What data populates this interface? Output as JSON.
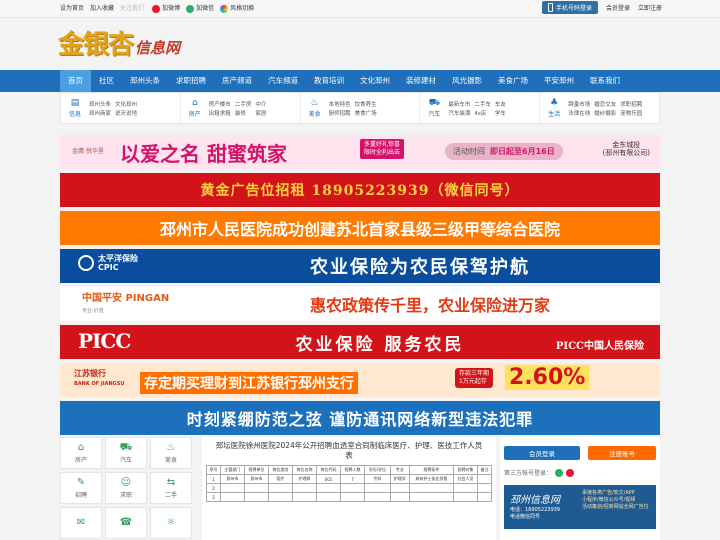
{
  "topbar": {
    "set_home": "设为首页",
    "add_fav": "加入收藏",
    "follow_us": "关注我们:",
    "weibo": "加微博",
    "wechat": "加微信",
    "style_switch": "风格切换",
    "mobile_login": "手机号码登录",
    "member_login": "会员登录",
    "logout": "立即注册"
  },
  "logo": {
    "main": "金银杏",
    "sub": "信息网"
  },
  "nav": {
    "items": [
      "首页",
      "社区",
      "邳州头条",
      "求职招聘",
      "房产频道",
      "汽车频道",
      "教育培训",
      "文化邳州",
      "装修建材",
      "风光摄影",
      "美食广场",
      "平安邳州",
      "联系我们"
    ]
  },
  "subnav": [
    {
      "cat": "信息",
      "glyph": "▤",
      "links": [
        "邳州头条",
        "文化邳州",
        "",
        "邳州商家",
        "说天说地",
        ""
      ]
    },
    {
      "cat": "房产",
      "glyph": "⌂",
      "links": [
        "房产楼市",
        "二手房",
        "中介",
        "出租求租",
        "装修",
        "家居"
      ]
    },
    {
      "cat": "美食",
      "glyph": "♨",
      "links": [
        "本地特色",
        "饮食养生",
        "",
        "厨师招聘",
        "美食广场",
        ""
      ]
    },
    {
      "cat": "汽车",
      "glyph": "⛟",
      "links": [
        "最新车市",
        "二手车",
        "车友",
        "汽车装潢",
        "4s店",
        "学车"
      ]
    },
    {
      "cat": "生活",
      "glyph": "♣",
      "links": [
        "跳蚤市场",
        "婚恋交友",
        "求职招聘",
        "法律在线",
        "婚纱摄影",
        "宠物乐园"
      ]
    }
  ],
  "banners": {
    "b1": {
      "brand": "金鹰·悦华里",
      "main": "以爱之名 甜蜜筑家",
      "badge1": "多重好礼惊喜",
      "badge2": "限时全利出击",
      "activity_label": "活动时间",
      "activity_date": "即日起至6月16日",
      "corner1": "金东城投",
      "corner2": "(邳州有限公司)"
    },
    "b2": {
      "text": "黄金广告位招租 18905223939（微信同号）"
    },
    "b3": {
      "text": "邳州市人民医院成功创建苏北首家县级三级甲等综合医院"
    },
    "b4": {
      "logo_cn": "太平洋保险",
      "logo_en": "CPIC",
      "text": "农业保险为农民保驾护航"
    },
    "b5": {
      "logo": "中国平安 PINGAN",
      "logo_sub": "专业·价值",
      "text": "惠农政策传千里，农业保险进万家"
    },
    "b6": {
      "logo": "PICC",
      "text": "农业保险  服务农民",
      "tag": "PICC中国人民保险"
    },
    "b7": {
      "logo": "江苏银行",
      "logo_sub": "BANK OF JIANGSU",
      "text": "存定期买理财到江苏银行邳州支行",
      "mid1": "存款三年期",
      "mid2": "1万元起存",
      "rate": "2.60%"
    },
    "b8": {
      "text": "时刻紧绷防范之弦  谨防通讯网络新型违法犯罪"
    }
  },
  "side_icons": [
    {
      "label": "房产",
      "glyph": "⌂"
    },
    {
      "label": "汽车",
      "glyph": "⛟"
    },
    {
      "label": "美食",
      "glyph": "♨"
    },
    {
      "label": "招聘",
      "glyph": "✎"
    },
    {
      "label": "求职",
      "glyph": "☺"
    },
    {
      "label": "二手",
      "glyph": "⇆"
    },
    {
      "label": "",
      "glyph": "✉"
    },
    {
      "label": "",
      "glyph": "☎"
    },
    {
      "label": "",
      "glyph": "☼"
    }
  ],
  "article": {
    "title_line1": "邳坛医院徐州医院2024年公开招聘血透室合同制临床医疗、护理、医技工作人员",
    "title_line2": "表",
    "headers": [
      "序号",
      "主管部门",
      "招聘单位",
      "岗位类别",
      "岗位名称",
      "岗位代码",
      "招聘人数",
      "学历/学位",
      "专业",
      "招聘条件",
      "招聘对象",
      "备注"
    ],
    "rows": [
      [
        "1",
        "邳州市",
        "邳州市",
        "医疗",
        "护理岗",
        "001",
        "7",
        "专科",
        "护理学",
        "具有护士执业资格",
        "社会人员",
        ""
      ],
      [
        "2",
        "",
        "",
        "",
        "",
        "",
        "",
        "",
        "",
        "",
        "",
        ""
      ],
      [
        "3",
        "",
        "",
        "",
        "",
        "",
        "",
        "",
        "",
        "",
        "",
        ""
      ]
    ]
  },
  "panel": {
    "login": "会员登录",
    "register": "注册账号",
    "third_party": "第三方帐号登录：",
    "ad_name": "邳州信息网",
    "ad_phone1": "电话：18905223939",
    "ad_phone2": "电话微信同号",
    "ad_lines": [
      "承接各类广告/软文/APP",
      "小程序/微信公众号/视频",
      "活动策划/招商网站全网广告位"
    ]
  }
}
